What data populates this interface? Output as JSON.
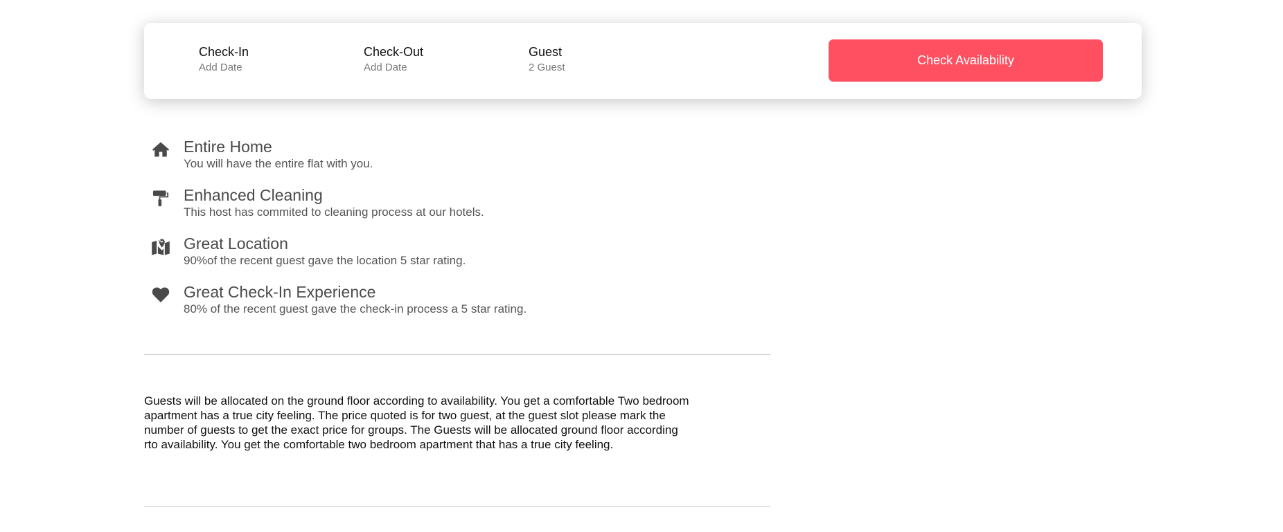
{
  "booking": {
    "checkin_label": "Check-In",
    "checkin_value": "Add Date",
    "checkout_label": "Check-Out",
    "checkout_value": "Add Date",
    "guest_label": "Guest",
    "guest_value": "2 Guest",
    "button_label": "Check Availability",
    "button_color": "#ff5062"
  },
  "features": [
    {
      "icon": "home-icon",
      "title": "Entire Home",
      "desc": "You will have the entire flat with you."
    },
    {
      "icon": "paint-roller-icon",
      "title": "Enhanced Cleaning",
      "desc": "This host has commited to cleaning process at our hotels."
    },
    {
      "icon": "map-location-icon",
      "title": "Great Location",
      "desc": "90%of the recent guest gave the location 5 star rating."
    },
    {
      "icon": "heart-icon",
      "title": "Great Check-In Experience",
      "desc": "80% of the recent guest gave the check-in process a 5 star rating."
    }
  ],
  "description": "Guests will be allocated on the ground floor according to availability. You get a comfortable Two bedroom apartment has a true city feeling. The price quoted is for two guest, at the guest slot please mark the number of guests to get the exact price for groups. The Guests will be allocated ground floor according rto availability. You get the comfortable two bedroom apartment that has a true city feeling."
}
